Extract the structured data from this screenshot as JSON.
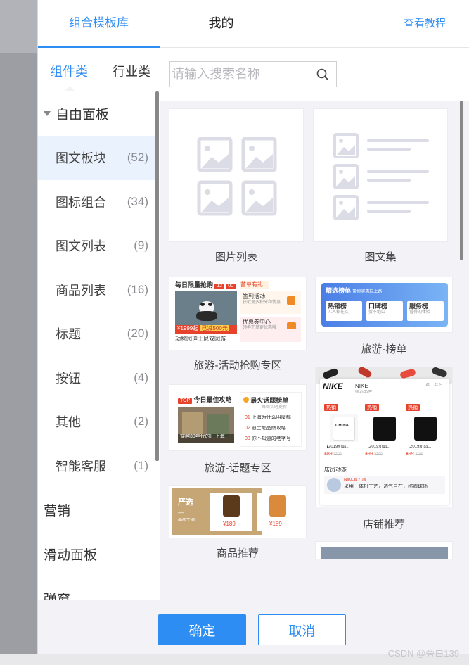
{
  "top_tabs": [
    {
      "label": "组合模板库"
    },
    {
      "label": "我的"
    }
  ],
  "tutorial_link": "查看教程",
  "sub_tabs": [
    {
      "label": "组件类"
    },
    {
      "label": "行业类"
    }
  ],
  "search": {
    "placeholder": "请输入搜索名称",
    "value": ""
  },
  "sidebar": {
    "group_free": "自由面板",
    "items": [
      {
        "label": "图文板块",
        "count": "(52)",
        "active": true
      },
      {
        "label": "图标组合",
        "count": "(34)"
      },
      {
        "label": "图文列表",
        "count": "(9)"
      },
      {
        "label": "商品列表",
        "count": "(16)"
      },
      {
        "label": "标题",
        "count": "(20)"
      },
      {
        "label": "按钮",
        "count": "(4)"
      },
      {
        "label": "其他",
        "count": "(2)"
      },
      {
        "label": "智能客服",
        "count": "(1)"
      }
    ],
    "group_marketing": "营销",
    "group_slide": "滑动面板",
    "group_popup": "弹窗"
  },
  "templates": {
    "pic_list": "图片列表",
    "pic_text_set": "图文集",
    "travel_flash": "旅游-活动抢购专区",
    "travel_rank": "旅游-榜单",
    "travel_topic": "旅游-话题专区",
    "shop_recommend": "店铺推荐",
    "product_recommend": "商品推荐"
  },
  "thumb_flash": {
    "title": "每日限量抢购",
    "timer_h": "12",
    "timer_m": "00",
    "tag_hot": "首单有礼",
    "sign_title": "签到活动",
    "sign_sub": "获取更多积分和优惠",
    "price": "¥1999起",
    "discount": "已减500元",
    "coupon_title": "优惠券中心",
    "coupon_sub": "领券下单更优惠哦",
    "caption": "动物园迪士尼双园游"
  },
  "thumb_rank": {
    "title": "精选榜单",
    "subtitle": "带你实惠玩上路",
    "items": [
      {
        "name": "热销榜",
        "sub": "人人都在买"
      },
      {
        "name": "口碑榜",
        "sub": "赞不绝口"
      },
      {
        "name": "服务榜",
        "sub": "看得的体验"
      }
    ]
  },
  "thumb_topic": {
    "left_tag": "TOP",
    "left_title": "今日最佳攻略",
    "left_caption": "穿越30年代的旧上海",
    "right_title": "最火话题榜单",
    "right_sub": "每周实时更新",
    "topics": [
      {
        "no": "01",
        "text": "上海为什么叫魔都"
      },
      {
        "no": "02",
        "text": "迪士尼品牌攻略"
      },
      {
        "no": "03",
        "text": "你不知道的老字号"
      }
    ]
  },
  "thumb_shop": {
    "brand_logo": "NIKE",
    "brand_name": "NIKE",
    "brand_sub": "精选品牌",
    "enter": "逛一逛 >",
    "hot_tag": "热销",
    "products": [
      {
        "name": "【2019新品...",
        "price": "¥89",
        "old": "¥199",
        "print": "CHINA"
      },
      {
        "name": "【2019新品...",
        "price": "¥99",
        "old": "¥199",
        "print": ""
      },
      {
        "name": "【2019新品...",
        "price": "¥99",
        "old": "¥199",
        "print": ""
      }
    ],
    "news_title": "店员动态",
    "news_name": "NIKE官方店",
    "news_text": "采用一体机工艺，透气自在，称霸球场"
  },
  "thumb_product": {
    "tag": "严选",
    "dash": "—",
    "sub": "品质生活",
    "price1": "¥189",
    "price2": "¥189"
  },
  "buttons": {
    "ok": "确定",
    "cancel": "取消"
  },
  "watermark": "CSDN @旁白139",
  "colors": {
    "accent": "#2e8df2",
    "hot": "#e7422c",
    "panel_bg": "#f3f3f7"
  }
}
